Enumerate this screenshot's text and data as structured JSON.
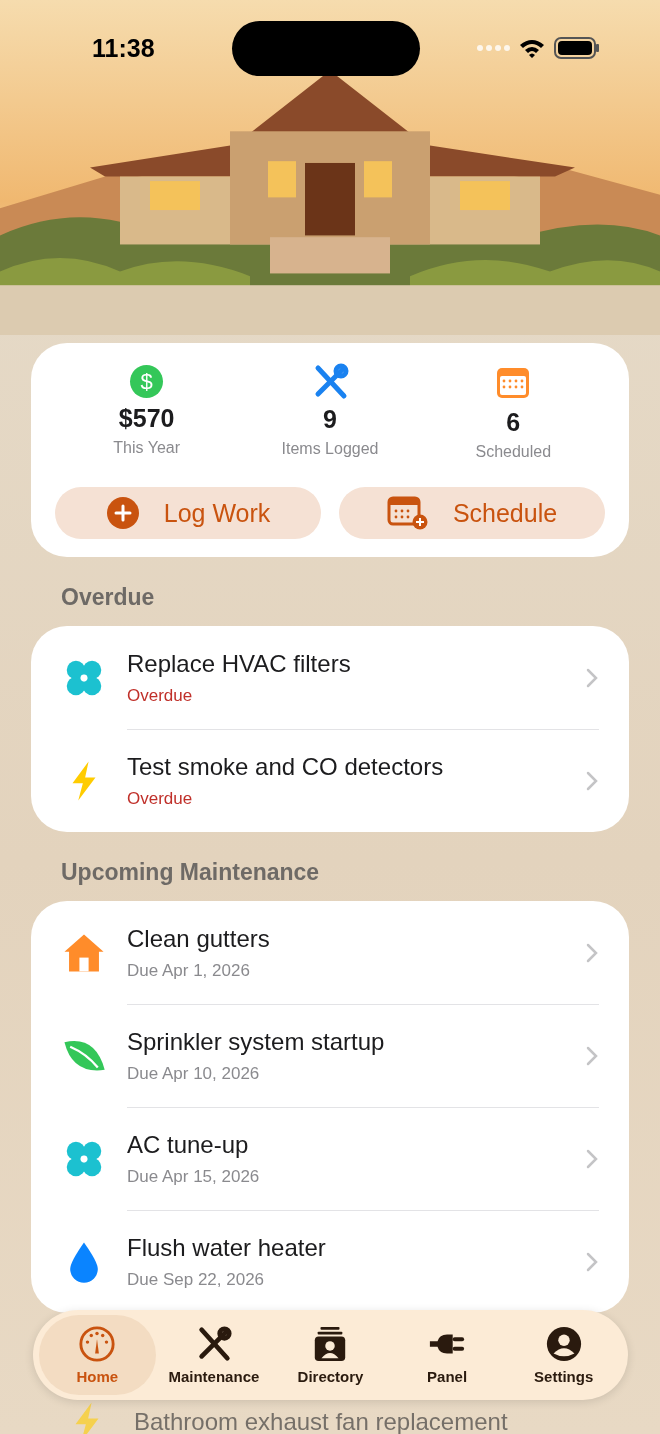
{
  "status_bar": {
    "time": "11:38"
  },
  "stats": [
    {
      "kind": "money",
      "glyph": "$",
      "value": "$570",
      "label": "This Year"
    },
    {
      "kind": "tools",
      "value": "9",
      "label": "Items Logged"
    },
    {
      "kind": "calendar",
      "value": "6",
      "label": "Scheduled"
    }
  ],
  "actions": [
    {
      "kind": "add",
      "label": "Log Work"
    },
    {
      "kind": "schedule",
      "label": "Schedule"
    }
  ],
  "sections": [
    {
      "title": "Overdue",
      "items": [
        {
          "kind": "fan",
          "title": "Replace HVAC filters",
          "subtitle": "Overdue",
          "overdue": true
        },
        {
          "kind": "bolt",
          "title": "Test smoke and CO detectors",
          "subtitle": "Overdue",
          "overdue": true
        }
      ]
    },
    {
      "title": "Upcoming Maintenance",
      "items": [
        {
          "kind": "house",
          "title": "Clean gutters",
          "subtitle": "Due Apr 1, 2026",
          "overdue": false
        },
        {
          "kind": "leaf",
          "title": "Sprinkler system startup",
          "subtitle": "Due Apr 10, 2026",
          "overdue": false
        },
        {
          "kind": "fan",
          "title": "AC tune-up",
          "subtitle": "Due Apr 15, 2026",
          "overdue": false
        },
        {
          "kind": "drop",
          "title": "Flush water heater",
          "subtitle": "Due Sep 22, 2026",
          "overdue": false
        }
      ]
    }
  ],
  "peek_item": {
    "kind": "bolt",
    "title": "Bathroom exhaust fan replacement"
  },
  "tabs": [
    {
      "kind": "gauge",
      "label": "Home",
      "selected": true
    },
    {
      "kind": "tools",
      "label": "Maintenance",
      "selected": false
    },
    {
      "kind": "directory",
      "label": "Directory",
      "selected": false
    },
    {
      "kind": "plug",
      "label": "Panel",
      "selected": false
    },
    {
      "kind": "person",
      "label": "Settings",
      "selected": false
    }
  ]
}
